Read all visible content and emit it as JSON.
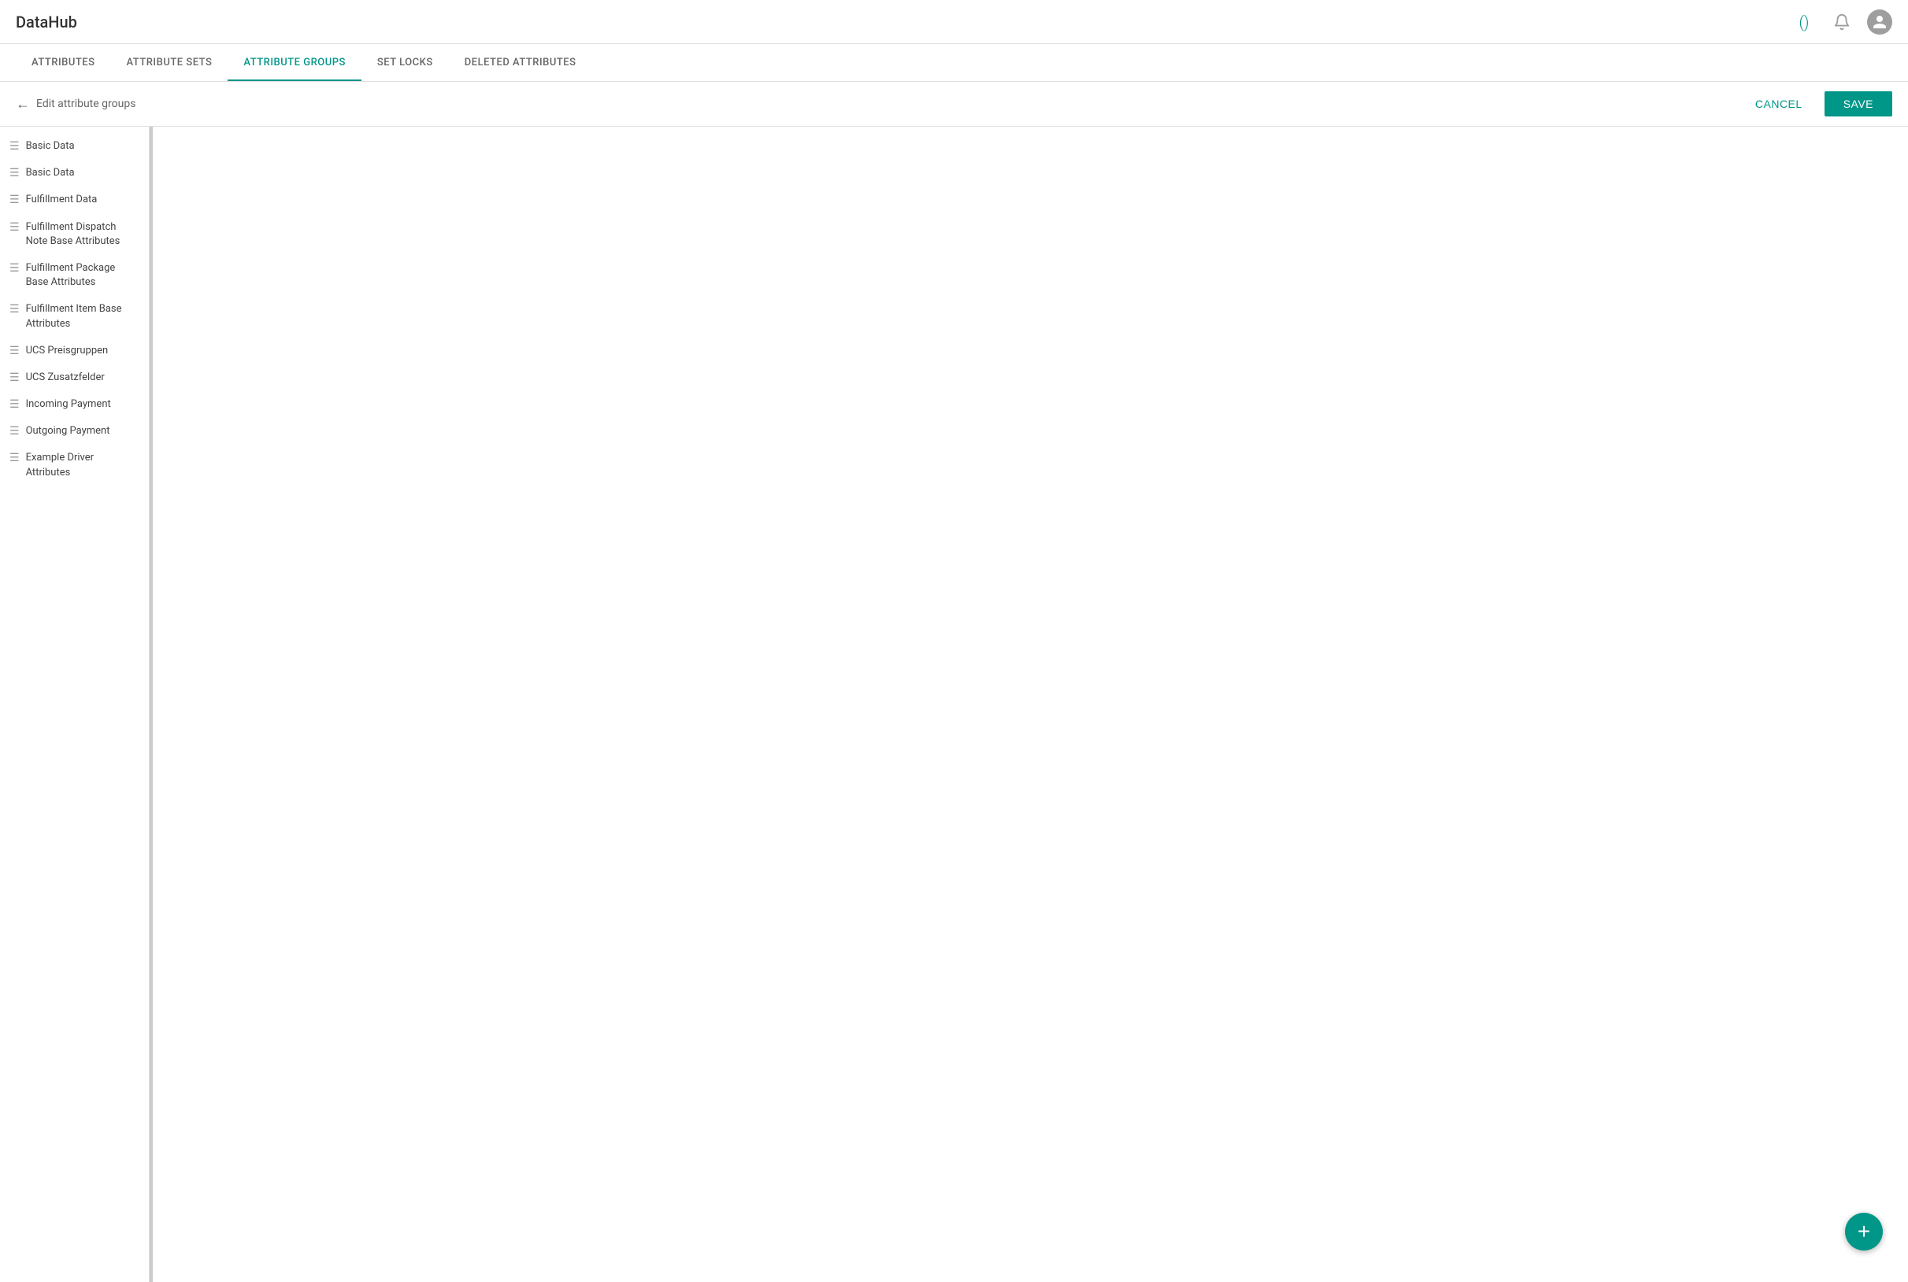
{
  "header": {
    "logo": "DataHub",
    "brackets_icon": "()",
    "bell_icon": "🔔",
    "avatar_icon": "👤"
  },
  "nav": {
    "tabs": [
      {
        "id": "attributes",
        "label": "ATTRIBUTES",
        "active": false
      },
      {
        "id": "attribute-sets",
        "label": "ATTRIBUTE SETS",
        "active": false
      },
      {
        "id": "attribute-groups",
        "label": "ATTRIBUTE GROUPS",
        "active": true
      },
      {
        "id": "set-locks",
        "label": "SET LOCKS",
        "active": false
      },
      {
        "id": "deleted-attributes",
        "label": "DELETED ATTRIBUTES",
        "active": false
      }
    ]
  },
  "edit_bar": {
    "back_label": "Edit attribute groups",
    "cancel_label": "CANCEL",
    "save_label": "SAVE"
  },
  "sidebar": {
    "items": [
      {
        "id": "basic-data-1",
        "label": "Basic Data"
      },
      {
        "id": "basic-data-2",
        "label": "Basic Data"
      },
      {
        "id": "fulfillment-data",
        "label": "Fulfillment Data"
      },
      {
        "id": "fulfillment-dispatch-note",
        "label": "Fulfillment Dispatch Note Base Attributes"
      },
      {
        "id": "fulfillment-package",
        "label": "Fulfillment Package Base Attributes"
      },
      {
        "id": "fulfillment-item",
        "label": "Fulfillment Item Base Attributes"
      },
      {
        "id": "ucs-preisgruppen",
        "label": "UCS Preisgruppen"
      },
      {
        "id": "ucs-zusatzfelder",
        "label": "UCS Zusatzfelder"
      },
      {
        "id": "incoming-payment",
        "label": "Incoming Payment"
      },
      {
        "id": "outgoing-payment",
        "label": "Outgoing Payment"
      },
      {
        "id": "example-driver",
        "label": "Example Driver Attributes"
      }
    ]
  },
  "fab": {
    "label": "+"
  }
}
